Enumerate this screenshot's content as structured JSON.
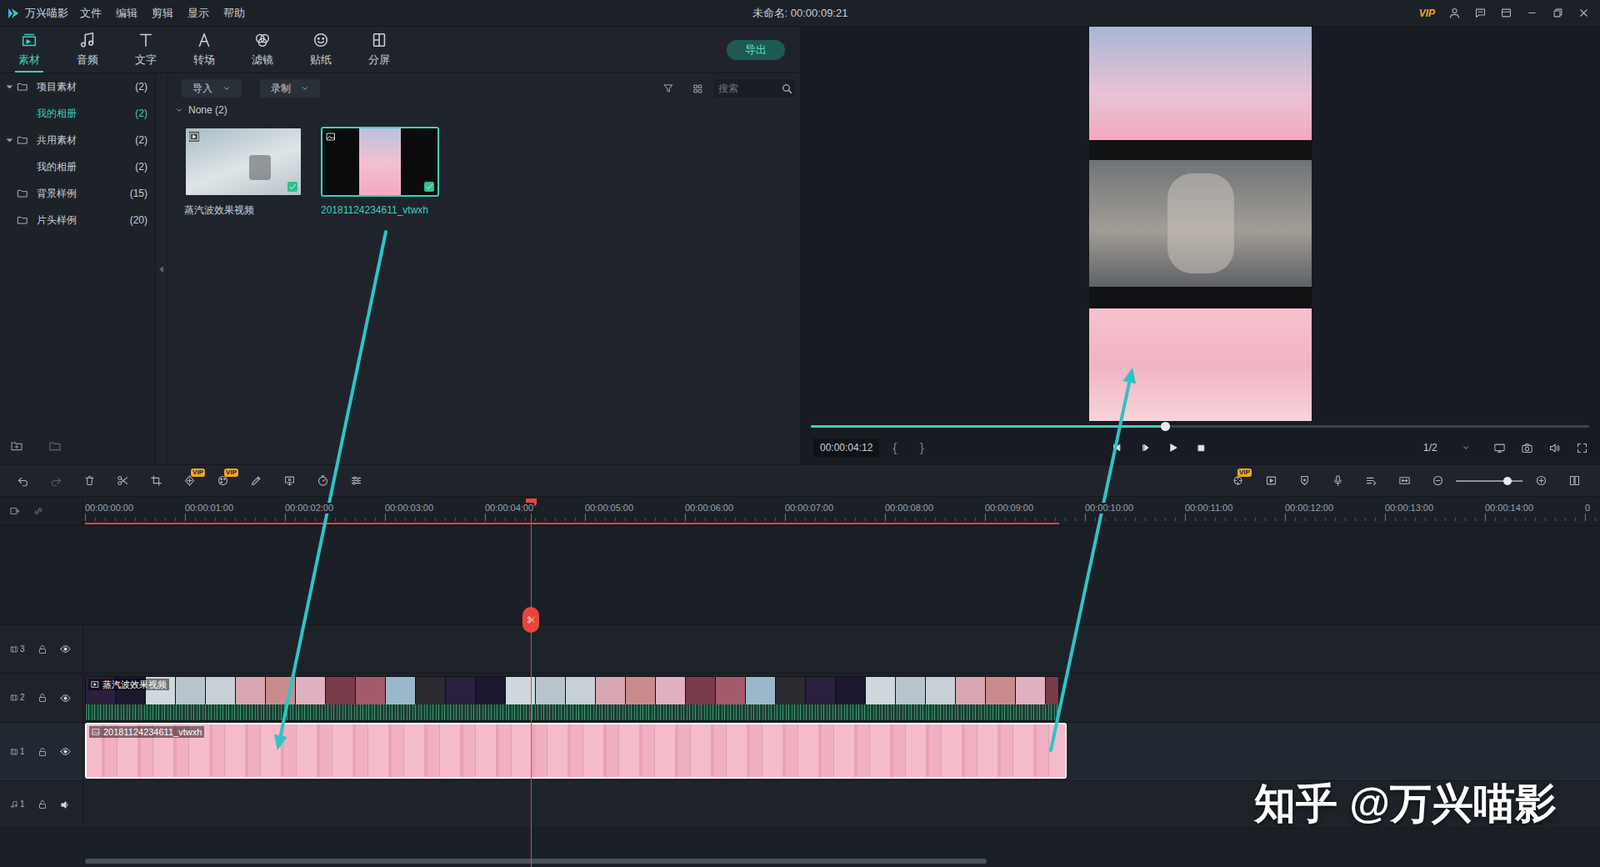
{
  "window": {
    "app_name": "万兴喵影",
    "title": "未命名: 00:00:09:21",
    "vip": "VIP"
  },
  "menu": [
    "文件",
    "编辑",
    "剪辑",
    "显示",
    "帮助"
  ],
  "toolbar_tabs": [
    {
      "label": "素材",
      "selected": true
    },
    {
      "label": "音频",
      "selected": false
    },
    {
      "label": "文字",
      "selected": false
    },
    {
      "label": "转场",
      "selected": false
    },
    {
      "label": "滤镜",
      "selected": false
    },
    {
      "label": "贴纸",
      "selected": false
    },
    {
      "label": "分屏",
      "selected": false
    }
  ],
  "export_button": "导出",
  "library": [
    {
      "label": "项目素材",
      "count": "(2)",
      "kind": "group",
      "expanded": true,
      "selected": false
    },
    {
      "label": "我的相册",
      "count": "(2)",
      "kind": "child",
      "expanded": false,
      "selected": true
    },
    {
      "label": "共用素材",
      "count": "(2)",
      "kind": "group",
      "expanded": true,
      "selected": false
    },
    {
      "label": "我的相册",
      "count": "(2)",
      "kind": "child",
      "expanded": false,
      "selected": false
    },
    {
      "label": "背景样例",
      "count": "(15)",
      "kind": "folder",
      "expanded": false,
      "selected": false
    },
    {
      "label": "片头样例",
      "count": "(20)",
      "kind": "folder",
      "expanded": false,
      "selected": false
    }
  ],
  "media_toolbar": {
    "import": "导入",
    "record": "录制",
    "search_placeholder": "搜索"
  },
  "media_group": {
    "label": "None (2)",
    "expanded": true
  },
  "media_items": [
    {
      "name": "蒸汽波效果视频",
      "kind": "video",
      "selected": false,
      "added": true
    },
    {
      "name": "20181124234611_vtwxh",
      "kind": "image",
      "selected": true,
      "added": true
    }
  ],
  "preview": {
    "time": "00:00:04:12",
    "mark_in": "{",
    "mark_out": "}",
    "quality": "1/2",
    "level": 0.455
  },
  "timeline": {
    "left_badges": [
      "VIP",
      "VIP"
    ],
    "right_badge": "VIP",
    "zoom_level": 0.77,
    "ruler": [
      "00:00:00:00",
      "00:00:01:00",
      "00:00:02:00",
      "00:00:03:00",
      "00:00:04:00",
      "00:00:05:00",
      "00:00:06:00",
      "00:00:07:00",
      "00:00:08:00",
      "00:00:09:00",
      "00:00:10:00",
      "00:00:11:00",
      "00:00:12:00",
      "00:00:13:00",
      "00:00:14:00",
      "0"
    ],
    "playhead_seconds": 4.46,
    "work_area_end": 9.74,
    "scrollbar_level": 0.6,
    "tracks": [
      {
        "label": "3",
        "kind": "video",
        "locked": false,
        "visible": true,
        "selected": false,
        "clips": []
      },
      {
        "label": "2",
        "kind": "video",
        "locked": false,
        "visible": true,
        "selected": false,
        "clips": [
          {
            "name": "蒸汽波效果视频",
            "kind": "video",
            "start": 0,
            "end": 9.74,
            "selected": false
          }
        ]
      },
      {
        "label": "1",
        "kind": "video",
        "locked": false,
        "visible": true,
        "selected": true,
        "clips": [
          {
            "name": "20181124234611_vtwxh",
            "kind": "image",
            "start": 0,
            "end": 9.82,
            "selected": true
          }
        ]
      },
      {
        "label": "1",
        "kind": "audio",
        "locked": false,
        "visible": true,
        "selected": false,
        "clips": []
      }
    ]
  },
  "watermark": "知乎 @万兴喵影"
}
